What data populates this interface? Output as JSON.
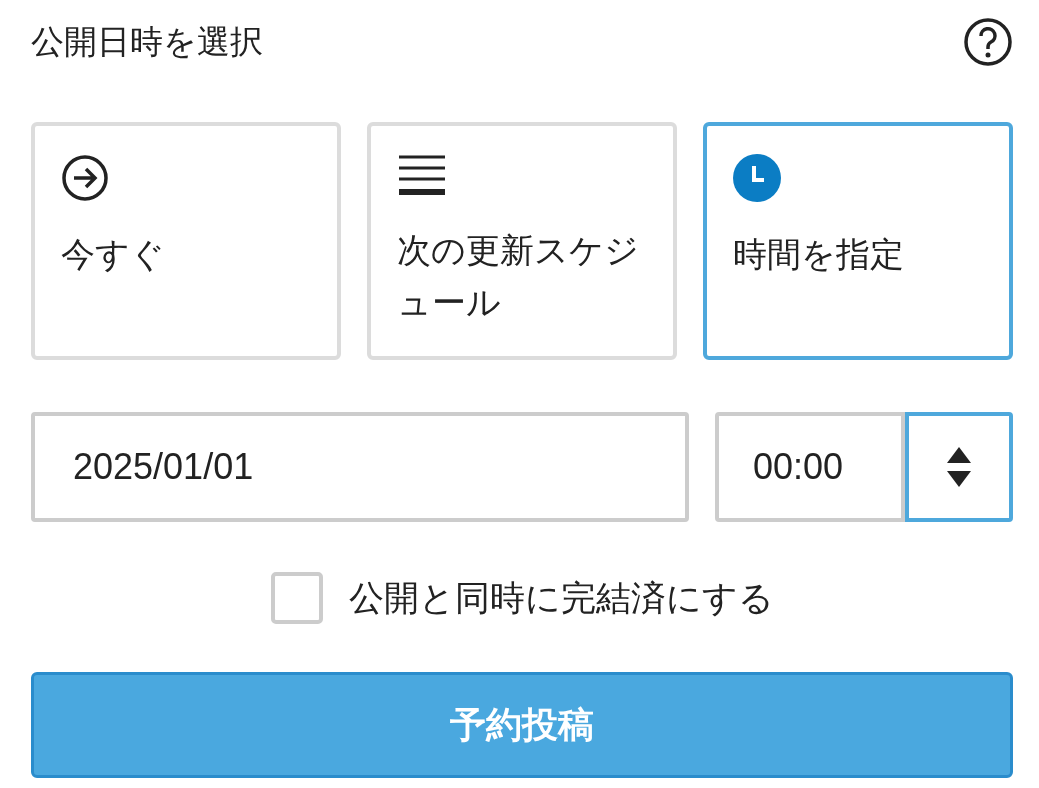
{
  "title": "公開日時を選択",
  "options": [
    {
      "kind": "now",
      "label": "今すぐ",
      "selected": false
    },
    {
      "kind": "schedule",
      "label": "次の更新スケジュール",
      "selected": false
    },
    {
      "kind": "time",
      "label": "時間を指定",
      "selected": true
    }
  ],
  "date": {
    "value": "2025/01/01"
  },
  "time": {
    "value": "00:00"
  },
  "complete": {
    "label": "公開と同時に完結済にする",
    "checked": false
  },
  "submit": {
    "label": "予約投稿"
  }
}
